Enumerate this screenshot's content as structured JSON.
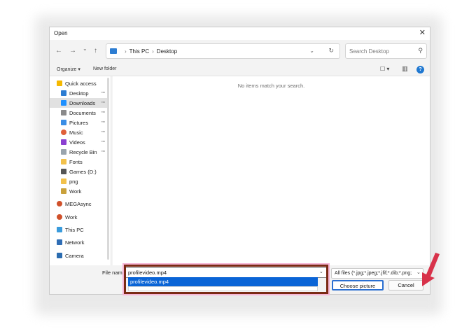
{
  "dialog": {
    "title": "Open",
    "close_glyph": "✕"
  },
  "nav": {
    "back_glyph": "←",
    "forward_glyph": "→",
    "recent_glyph": "⌄",
    "up_glyph": "↑"
  },
  "address": {
    "crumbs": [
      "This PC",
      "Desktop"
    ],
    "separator": "›",
    "dropdown_glyph": "⌄",
    "refresh_glyph": "↻"
  },
  "search": {
    "placeholder": "Search Desktop",
    "icon": "search-icon"
  },
  "commandbar": {
    "organize": "Organize ▾",
    "new_folder": "New folder",
    "view_glyph": "☐ ▾",
    "pane_glyph": "▥",
    "help_glyph": "?"
  },
  "sidebar": {
    "items": [
      {
        "label": "Quick access",
        "icon": "star-icon",
        "color": "#f5b800",
        "pinned": false
      },
      {
        "label": "Desktop",
        "icon": "desktop-icon",
        "color": "#2d7dd2",
        "pinned": true
      },
      {
        "label": "Downloads",
        "icon": "download-icon",
        "color": "#1e90ff",
        "pinned": true
      },
      {
        "label": "Documents",
        "icon": "documents-icon",
        "color": "#8a8a8a",
        "pinned": true
      },
      {
        "label": "Pictures",
        "icon": "pictures-icon",
        "color": "#3a8ee6",
        "pinned": true
      },
      {
        "label": "Music",
        "icon": "music-icon",
        "color": "#e0603a",
        "pinned": true
      },
      {
        "label": "Videos",
        "icon": "videos-icon",
        "color": "#8b3fd1",
        "pinned": true
      },
      {
        "label": "Recycle Bin",
        "icon": "recycle-bin-icon",
        "color": "#9aa4ad",
        "pinned": true
      },
      {
        "label": "Fonts",
        "icon": "folder-icon",
        "color": "#f2c14b",
        "pinned": false
      },
      {
        "label": "Games (D:)",
        "icon": "drive-icon",
        "color": "#555555",
        "pinned": false
      },
      {
        "label": "png",
        "icon": "folder-icon",
        "color": "#f2c14b",
        "pinned": false
      },
      {
        "label": "Work",
        "icon": "folder-icon",
        "color": "#c9a13b",
        "pinned": false
      },
      {
        "label": "MEGAsync",
        "icon": "user-folder-icon",
        "color": "#d0502a",
        "pinned": false
      },
      {
        "label": "Work",
        "icon": "user-folder-icon",
        "color": "#d0502a",
        "pinned": false
      },
      {
        "label": "This PC",
        "icon": "computer-icon",
        "color": "#3a9bdc",
        "pinned": false
      },
      {
        "label": "Network",
        "icon": "network-icon",
        "color": "#2f6db5",
        "pinned": false
      },
      {
        "label": "Camera",
        "icon": "camera-icon",
        "color": "#2b6cb0",
        "pinned": false
      }
    ],
    "pin_glyph": "📌",
    "selected_index": 2
  },
  "content": {
    "empty_message": "No items match your search."
  },
  "footer": {
    "file_name_label": "File name:",
    "file_name_value": "profilevideo.mp4",
    "autocomplete_suggestion": "profilevideo.mp4",
    "file_type_value": "All files (*.jpg;*.jpeg;*.jfif;*.dib;*.png;",
    "dropdown_glyph": "⌄",
    "choose_button": "Choose picture",
    "cancel_button": "Cancel"
  },
  "annotation": {
    "highlight_color": "#7a2a14",
    "arrow_color": "#d8324a"
  }
}
